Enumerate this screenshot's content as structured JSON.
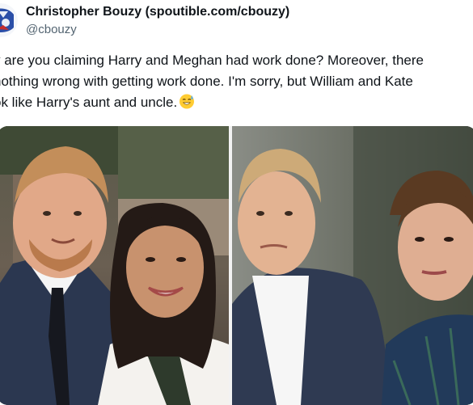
{
  "author": {
    "display_name": "Christopher Bouzy (spoutible.com/cbouzy)",
    "handle": "@cbouzy"
  },
  "tweet": {
    "lines": [
      "y are you claiming Harry and Meghan had work done? Moreover, there",
      "nothing wrong with getting work done. I'm sorry, but William and Kate",
      "ok like Harry's aunt and uncle."
    ],
    "emoji": "sweat-smile-emoji"
  },
  "media": {
    "left_photo": "photo-harry-meghan",
    "right_photo": "photo-william-kate"
  },
  "colors": {
    "text": "#0f1419",
    "muted": "#536471",
    "background": "#ffffff"
  }
}
